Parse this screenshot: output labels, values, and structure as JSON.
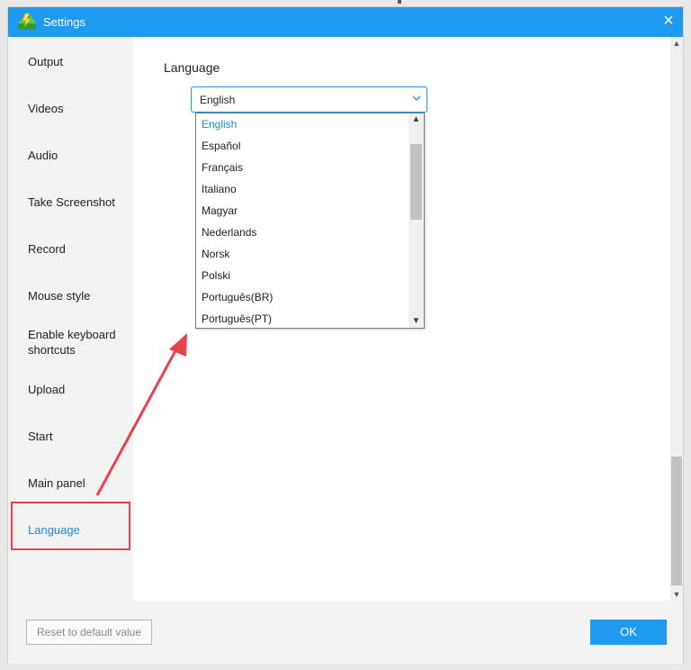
{
  "window": {
    "title": "Settings",
    "app_icon": "app-logo-icon",
    "close_icon": "close-icon"
  },
  "sidebar": {
    "items": [
      {
        "label": "Output"
      },
      {
        "label": "Videos"
      },
      {
        "label": "Audio"
      },
      {
        "label": "Take Screenshot"
      },
      {
        "label": "Record"
      },
      {
        "label": "Mouse style"
      },
      {
        "label": "Enable keyboard shortcuts"
      },
      {
        "label": "Upload"
      },
      {
        "label": "Start"
      },
      {
        "label": "Main panel"
      },
      {
        "label": "Language",
        "active": true
      }
    ]
  },
  "main": {
    "section_title": "Language",
    "language_select": {
      "value": "English",
      "options": [
        "English",
        "Español",
        "Français",
        "Italiano",
        "Magyar",
        "Nederlands",
        "Norsk",
        "Polski",
        "Português(BR)",
        "Português(PT)"
      ],
      "selected_index": 0
    }
  },
  "footer": {
    "reset_label": "Reset to default value",
    "ok_label": "OK"
  },
  "colors": {
    "accent": "#1e9bf0",
    "selected_text": "#1e88e5",
    "annotation_red": "#e8434a"
  }
}
